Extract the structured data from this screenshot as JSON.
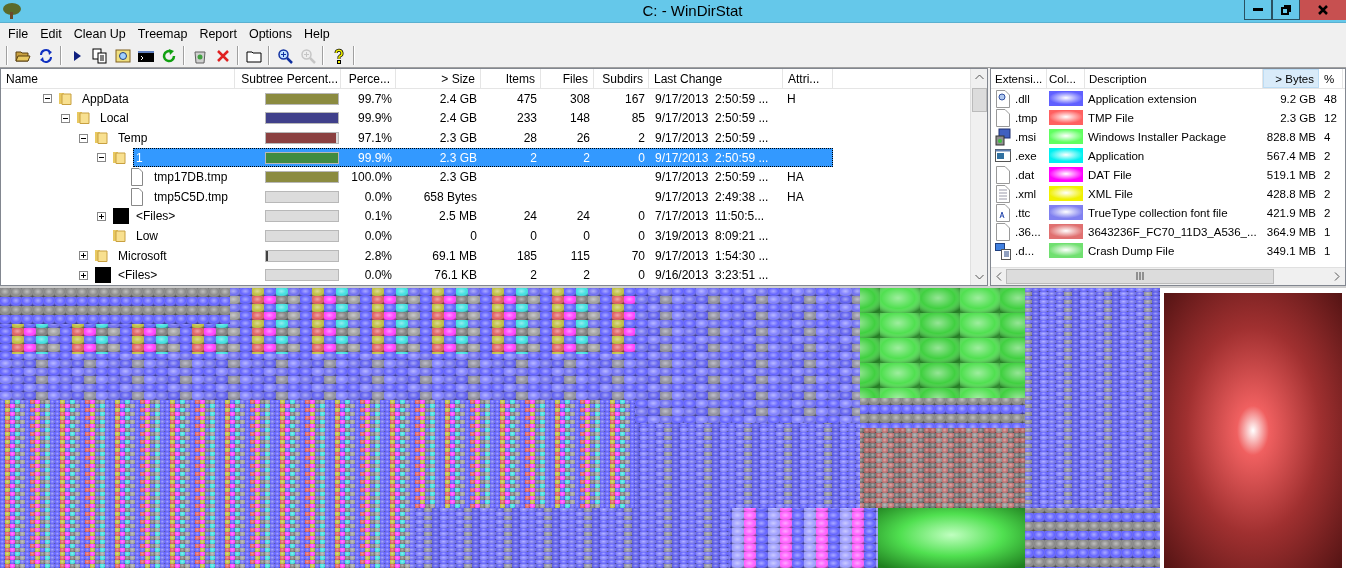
{
  "window": {
    "title": "C: - WinDirStat"
  },
  "menu": [
    "File",
    "Edit",
    "Clean Up",
    "Treemap",
    "Report",
    "Options",
    "Help"
  ],
  "toolbar": [
    [
      {
        "kind": "open",
        "disabled": false
      },
      {
        "kind": "refresh",
        "disabled": false
      }
    ],
    [
      {
        "kind": "play",
        "disabled": false
      },
      {
        "kind": "copy",
        "disabled": false
      },
      {
        "kind": "find",
        "disabled": false
      },
      {
        "kind": "console",
        "disabled": false
      },
      {
        "kind": "reload",
        "disabled": false
      }
    ],
    [
      {
        "kind": "recycle",
        "disabled": false
      },
      {
        "kind": "delete",
        "disabled": false
      }
    ],
    [
      {
        "kind": "folder",
        "disabled": false
      }
    ],
    [
      {
        "kind": "zoom-in",
        "disabled": false
      },
      {
        "kind": "zoom-out",
        "disabled": true
      }
    ],
    [
      {
        "kind": "help",
        "disabled": false
      }
    ]
  ],
  "tree": {
    "columns": [
      "Name",
      "Subtree Percent...",
      "Perce...",
      "> Size",
      "Items",
      "Files",
      "Subdirs",
      "Last Change",
      "Attri..."
    ],
    "rows": [
      {
        "name": "AppData",
        "kind": "folder",
        "expanded": true,
        "selected": false,
        "color": "#8b8b40",
        "level": 0.997,
        "percent": "99.7%",
        "size": "2.4 GB",
        "items": "475",
        "files": "308",
        "subdirs": "167",
        "last_change": "9/17/2013  2:50:59 ...",
        "attributes": "H",
        "children": [
          {
            "name": "Local",
            "kind": "folder",
            "expanded": true,
            "selected": false,
            "color": "#40408b",
            "level": 0.999,
            "percent": "99.9%",
            "size": "2.4 GB",
            "items": "233",
            "files": "148",
            "subdirs": "85",
            "last_change": "9/17/2013  2:50:59 ...",
            "children": [
              {
                "name": "Temp",
                "kind": "folder",
                "expanded": true,
                "selected": false,
                "color": "#8b4040",
                "level": 0.971,
                "percent": "97.1%",
                "size": "2.3 GB",
                "items": "28",
                "files": "26",
                "subdirs": "2",
                "last_change": "9/17/2013  2:50:59 ...",
                "children": [
                  {
                    "name": "1",
                    "kind": "folder",
                    "expanded": true,
                    "selected": true,
                    "color": "#408b40",
                    "level": 0.999,
                    "percent": "99.9%",
                    "size": "2.3 GB",
                    "items": "2",
                    "files": "2",
                    "subdirs": "0",
                    "last_change": "9/17/2013  2:50:59 ...",
                    "children": [
                      {
                        "name": "tmp17DB.tmp",
                        "kind": "file",
                        "selected": false,
                        "color": "#8b8b40",
                        "level": 1.0,
                        "percent": "100.0%",
                        "size": "2.3 GB",
                        "last_change": "9/17/2013  2:50:59 ...",
                        "attributes": "HA"
                      },
                      {
                        "name": "tmp5C5D.tmp",
                        "kind": "file",
                        "selected": false,
                        "percent": "0.0%",
                        "size": "658 Bytes",
                        "last_change": "9/17/2013  2:49:38 ...",
                        "attributes": "HA"
                      }
                    ]
                  },
                  {
                    "name": "<Files>",
                    "kind": "files",
                    "expanded": false,
                    "selected": false,
                    "percent": "0.1%",
                    "size": "2.5 MB",
                    "items": "24",
                    "files": "24",
                    "subdirs": "0",
                    "last_change": "7/17/2013  11:50:5..."
                  },
                  {
                    "name": "Low",
                    "kind": "folder",
                    "selected": false,
                    "percent": "0.0%",
                    "size": "0",
                    "items": "0",
                    "files": "0",
                    "subdirs": "0",
                    "last_change": "3/19/2013  8:09:21 ..."
                  }
                ]
              },
              {
                "name": "Microsoft",
                "kind": "folder",
                "expanded": false,
                "selected": false,
                "color": "#404040",
                "level": 0.028,
                "percent": "2.8%",
                "size": "69.1 MB",
                "items": "185",
                "files": "115",
                "subdirs": "70",
                "last_change": "9/17/2013  1:54:30 ..."
              },
              {
                "name": "<Files>",
                "kind": "files",
                "expanded": false,
                "selected": false,
                "percent": "0.0%",
                "size": "76.1 KB",
                "items": "2",
                "files": "2",
                "subdirs": "0",
                "last_change": "9/16/2013  3:23:51 ..."
              }
            ]
          }
        ]
      }
    ]
  },
  "extensions": {
    "columns": [
      {
        "label": "Extensi...",
        "sorted": false
      },
      {
        "label": "Col...",
        "sorted": false
      },
      {
        "label": "Description",
        "sorted": false
      },
      {
        "label": "> Bytes",
        "sorted": true
      },
      {
        "label": "%",
        "sorted": false
      }
    ],
    "rows": [
      {
        "kind": "library",
        "extension": ".dll",
        "color": "#6060ff",
        "description": "Application extension",
        "bytes": "9.2 GB",
        "percent": "48"
      },
      {
        "kind": "document",
        "extension": ".tmp",
        "color": "#ff6060",
        "description": "TMP File",
        "bytes": "2.3 GB",
        "percent": "12"
      },
      {
        "kind": "installer",
        "extension": ".msi",
        "color": "#60ff60",
        "description": "Windows Installer Package",
        "bytes": "828.8 MB",
        "percent": "4"
      },
      {
        "kind": "program",
        "extension": ".exe",
        "color": "#00f0f0",
        "description": "Application",
        "bytes": "567.4 MB",
        "percent": "2"
      },
      {
        "kind": "document",
        "extension": ".dat",
        "color": "#ff00ff",
        "description": "DAT File",
        "bytes": "519.1 MB",
        "percent": "2"
      },
      {
        "kind": "text",
        "extension": ".xml",
        "color": "#f0f000",
        "description": "XML File",
        "bytes": "428.8 MB",
        "percent": "2"
      },
      {
        "kind": "font",
        "extension": ".ttc",
        "color": "#8080f0",
        "description": "TrueType collection font file",
        "bytes": "421.9 MB",
        "percent": "2"
      },
      {
        "kind": "document",
        "extension": ".36...",
        "color": "#e07070",
        "description": "3643236F_FC70_11D3_A536_...",
        "bytes": "364.9 MB",
        "percent": "1"
      },
      {
        "kind": "dump",
        "extension": ".d...",
        "color": "#70e070",
        "description": "Crash Dump File",
        "bytes": "349.1 MB",
        "percent": "1"
      }
    ]
  }
}
